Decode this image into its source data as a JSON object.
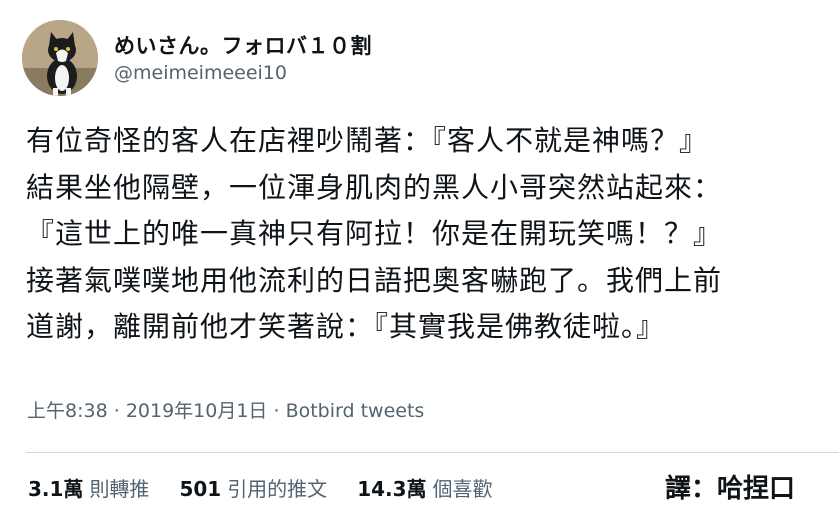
{
  "author": {
    "display_name": "めいさん。フォロバ１０割",
    "handle": "@meimeimeeei10",
    "avatar_icon": "cat-avatar-icon"
  },
  "tweet": {
    "lines": [
      "有位奇怪的客人在店裡吵鬧著：『客人不就是神嗎？』",
      "結果坐他隔壁，一位渾身肌肉的黑人小哥突然站起來：",
      "『這世上的唯一真神只有阿拉！你是在開玩笑嗎！？』",
      "接著氣噗噗地用他流利的日語把奧客嚇跑了。我們上前",
      "道謝，離開前他才笑著說：『其實我是佛教徒啦。』"
    ]
  },
  "meta": {
    "time": "上午8:38",
    "separator": "·",
    "date": "2019年10月1日",
    "source": "Botbird tweets"
  },
  "stats": {
    "retweets_count": "3.1萬",
    "retweets_label": "則轉推",
    "quotes_count": "501",
    "quotes_label": "引用的推文",
    "likes_count": "14.3萬",
    "likes_label": "個喜歡"
  },
  "credit": "譯：哈捏口"
}
